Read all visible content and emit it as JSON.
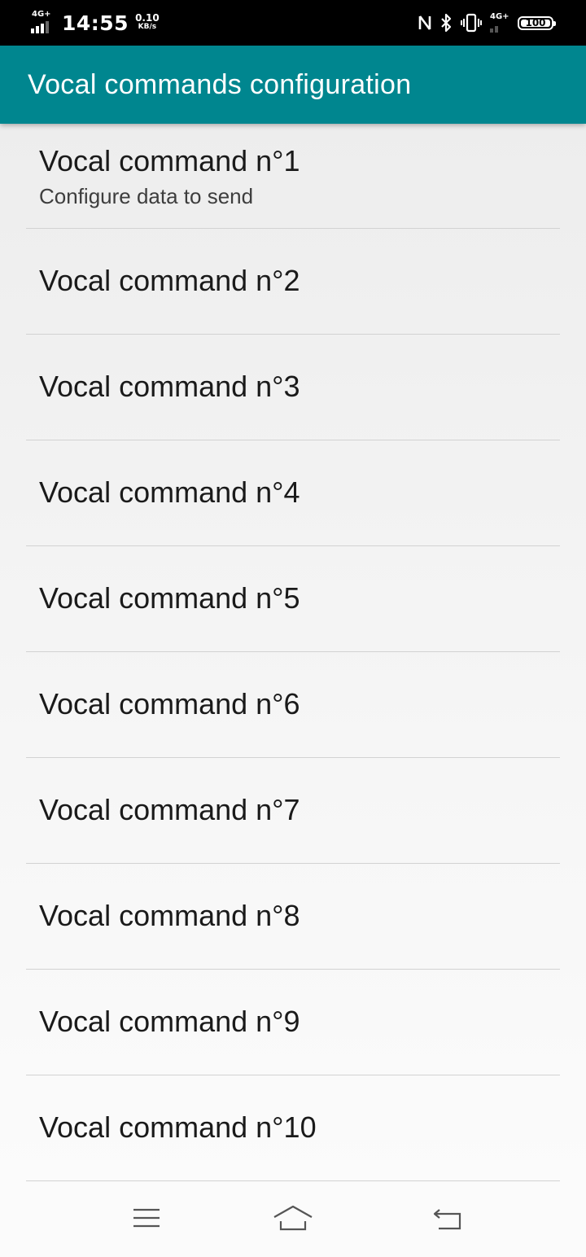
{
  "status_bar": {
    "network_type": "4G+",
    "time": "14:55",
    "net_speed_value": "0.10",
    "net_speed_unit": "KB/s",
    "network_type_2": "4G+",
    "battery_level": "100",
    "icons": [
      "signal-icon",
      "nfc-icon",
      "bluetooth-icon",
      "vibrate-icon",
      "signal-icon",
      "battery-icon"
    ]
  },
  "app_bar": {
    "title": "Vocal commands configuration",
    "color": "#00868f"
  },
  "commands": [
    {
      "title": "Vocal command n°1",
      "summary": "Configure data to send"
    },
    {
      "title": "Vocal command n°2"
    },
    {
      "title": "Vocal command n°3"
    },
    {
      "title": "Vocal command n°4"
    },
    {
      "title": "Vocal command n°5"
    },
    {
      "title": "Vocal command n°6"
    },
    {
      "title": "Vocal command n°7"
    },
    {
      "title": "Vocal command n°8"
    },
    {
      "title": "Vocal command n°9"
    },
    {
      "title": "Vocal command n°10"
    }
  ],
  "nav_bar": {
    "icons": [
      "menu-icon",
      "home-icon",
      "back-icon"
    ]
  }
}
